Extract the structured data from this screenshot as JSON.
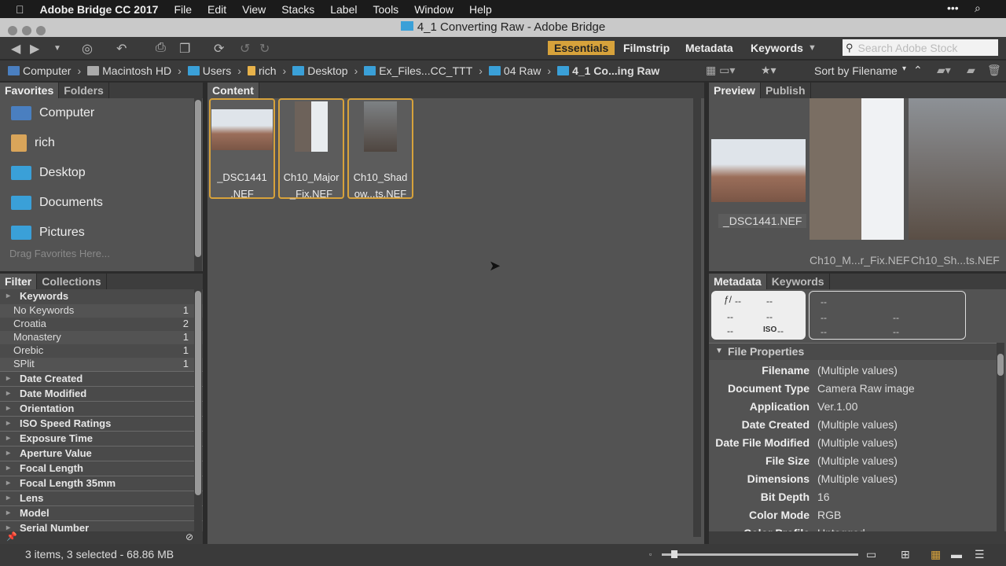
{
  "menubar": {
    "apple": "",
    "app": "Adobe Bridge CC 2017",
    "items": [
      "File",
      "Edit",
      "View",
      "Stacks",
      "Label",
      "Tools",
      "Window",
      "Help"
    ]
  },
  "window": {
    "title": "4_1 Converting Raw - Adobe Bridge"
  },
  "toolbar": {
    "workspaces": [
      "Essentials",
      "Filmstrip",
      "Metadata",
      "Keywords"
    ],
    "active_workspace": "Essentials",
    "search_placeholder": "Search Adobe Stock",
    "accent": "#d7a23b"
  },
  "path": {
    "crumbs": [
      "Computer",
      "Macintosh HD",
      "Users",
      "rich",
      "Desktop",
      "Ex_Files...CC_TTT",
      "04 Raw",
      "4_1 Co...ing Raw"
    ],
    "sort_label": "Sort by Filename"
  },
  "favorites": {
    "tabs": [
      "Favorites",
      "Folders"
    ],
    "items": [
      "Computer",
      "rich",
      "Desktop",
      "Documents",
      "Pictures"
    ],
    "drag_hint": "Drag Favorites Here..."
  },
  "filter": {
    "tabs": [
      "Filter",
      "Collections"
    ],
    "keywords_header": "Keywords",
    "keywords": [
      {
        "label": "No Keywords",
        "count": "1"
      },
      {
        "label": "Croatia",
        "count": "2"
      },
      {
        "label": "Monastery",
        "count": "1"
      },
      {
        "label": "Orebic",
        "count": "1"
      },
      {
        "label": "SPlit",
        "count": "1"
      }
    ],
    "sections": [
      "Date Created",
      "Date Modified",
      "Orientation",
      "ISO Speed Ratings",
      "Exposure Time",
      "Aperture Value",
      "Focal Length",
      "Focal Length 35mm",
      "Lens",
      "Model",
      "Serial Number"
    ]
  },
  "content": {
    "tab": "Content",
    "items": [
      {
        "name": "_DSC1441\n.NEF",
        "l1": "_DSC1441",
        "l2": ".NEF"
      },
      {
        "l1": "Ch10_Major",
        "l2": "_Fix.NEF"
      },
      {
        "l1": "Ch10_Shad",
        "l2": "ow...ts.NEF"
      }
    ]
  },
  "preview": {
    "tabs": [
      "Preview",
      "Publish"
    ],
    "captions": [
      "_DSC1441.NEF",
      "Ch10_M...r_Fix.NEF",
      "Ch10_Sh...ts.NEF"
    ]
  },
  "metadata": {
    "tabs": [
      "Metadata",
      "Keywords"
    ],
    "placeholder": "--",
    "iso": "ISO",
    "section": "File Properties",
    "rows": [
      {
        "k": "Filename",
        "v": "(Multiple values)"
      },
      {
        "k": "Document Type",
        "v": "Camera Raw image"
      },
      {
        "k": "Application",
        "v": "Ver.1.00"
      },
      {
        "k": "Date Created",
        "v": "(Multiple values)"
      },
      {
        "k": "Date File Modified",
        "v": "(Multiple values)"
      },
      {
        "k": "File Size",
        "v": "(Multiple values)"
      },
      {
        "k": "Dimensions",
        "v": "(Multiple values)"
      },
      {
        "k": "Bit Depth",
        "v": "16"
      },
      {
        "k": "Color Mode",
        "v": "RGB"
      },
      {
        "k": "Color Profile",
        "v": "Untagged"
      }
    ]
  },
  "status": {
    "text": "3 items, 3 selected - 68.86 MB"
  }
}
